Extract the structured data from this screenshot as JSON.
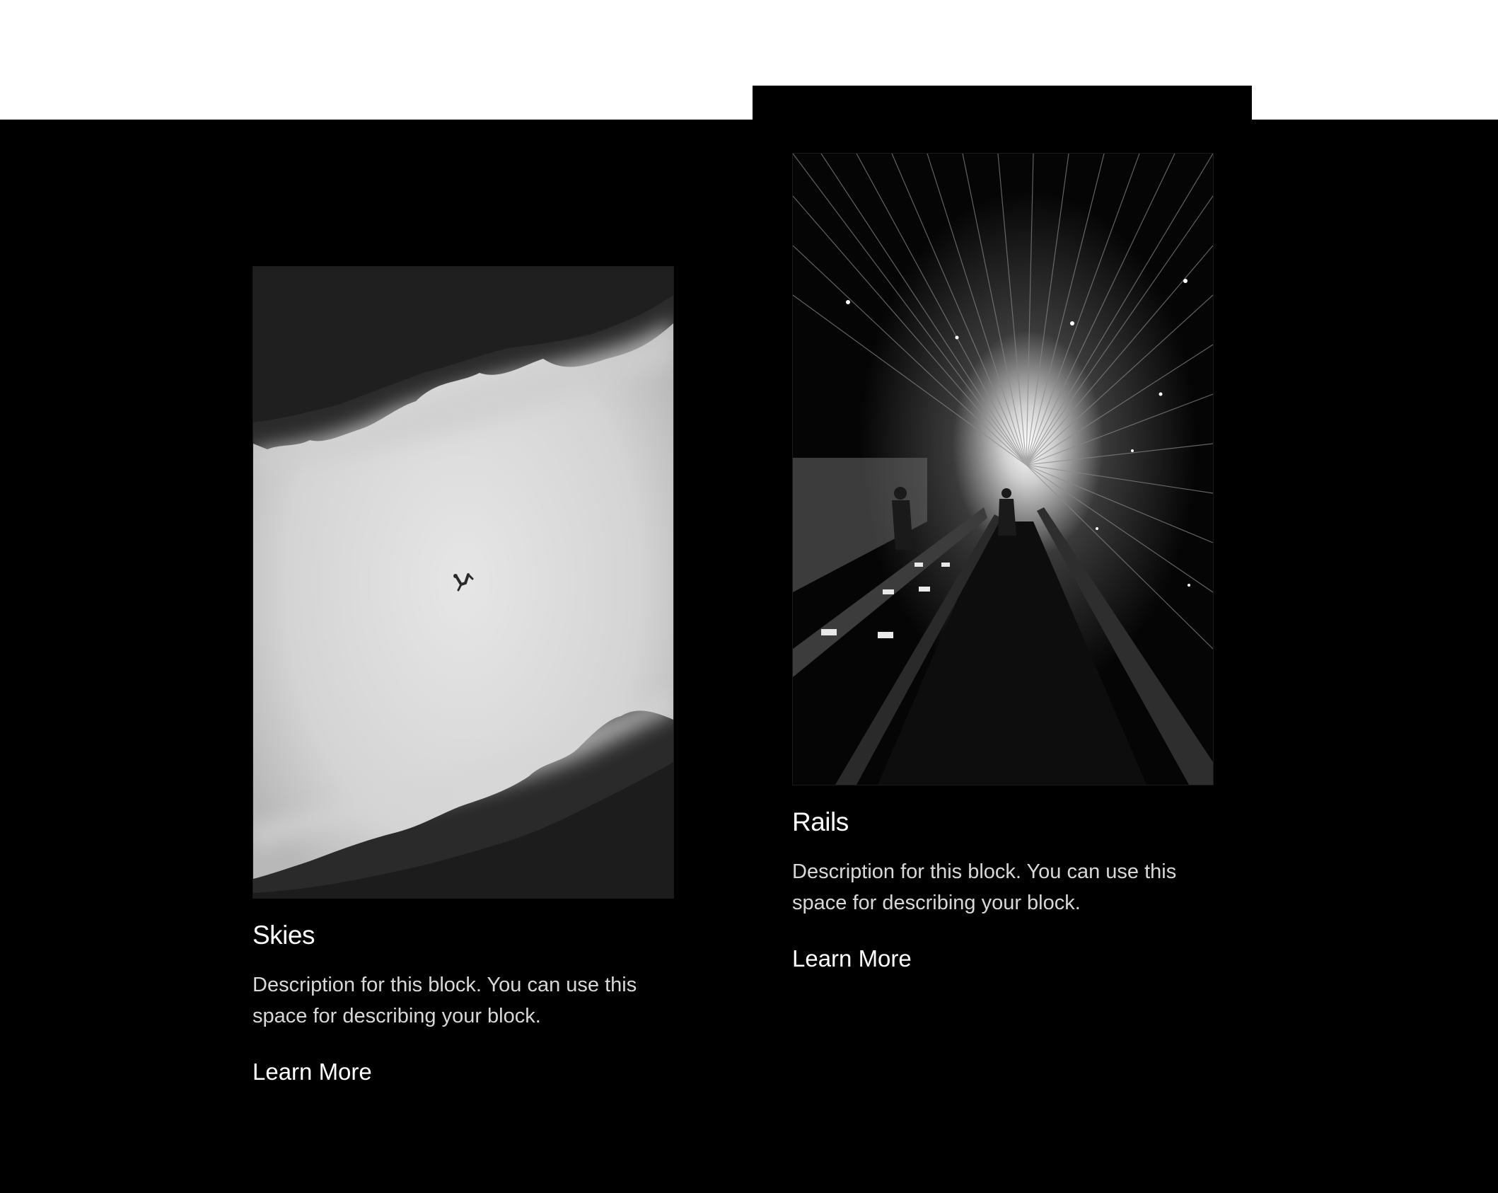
{
  "cards": [
    {
      "title": "Skies",
      "description": "Description for this block. You can use this space for describing your block.",
      "link_label": "Learn More",
      "image_icon": "skies-photo"
    },
    {
      "title": "Rails",
      "description": "Description for this block. You can use this space for describing your block.",
      "link_label": "Learn More",
      "image_icon": "rails-photo"
    }
  ],
  "colors": {
    "background": "#000000",
    "top_strip": "#ffffff",
    "title": "#ffffff",
    "description": "#d8d8d8"
  }
}
